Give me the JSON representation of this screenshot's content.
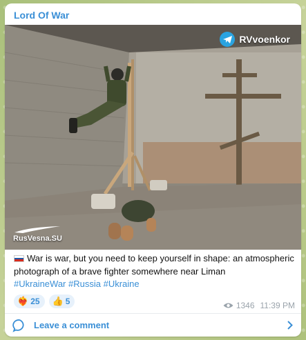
{
  "channel": {
    "name": "Lord Of War"
  },
  "photo": {
    "watermark_top": "RVvoenkor",
    "watermark_bottom": "RusVesna.SU"
  },
  "caption": {
    "text": "War is war, but you need to keep yourself in shape: an atmospheric photograph of a brave fighter somewhere near Liman",
    "hashtags": [
      "#UkraineWar",
      "#Russia",
      "#Ukraine"
    ],
    "flag": "russia-flag-icon"
  },
  "reactions": [
    {
      "icon": "heart-fire-icon",
      "count": "25"
    },
    {
      "icon": "thumbs-up-icon",
      "count": "5"
    }
  ],
  "meta": {
    "views": "1346",
    "time": "11:39 PM"
  },
  "comment": {
    "label": "Leave a comment"
  },
  "colors": {
    "accent": "#3a8fd6",
    "background": "#b9c88a",
    "muted": "#9aa3ab"
  }
}
